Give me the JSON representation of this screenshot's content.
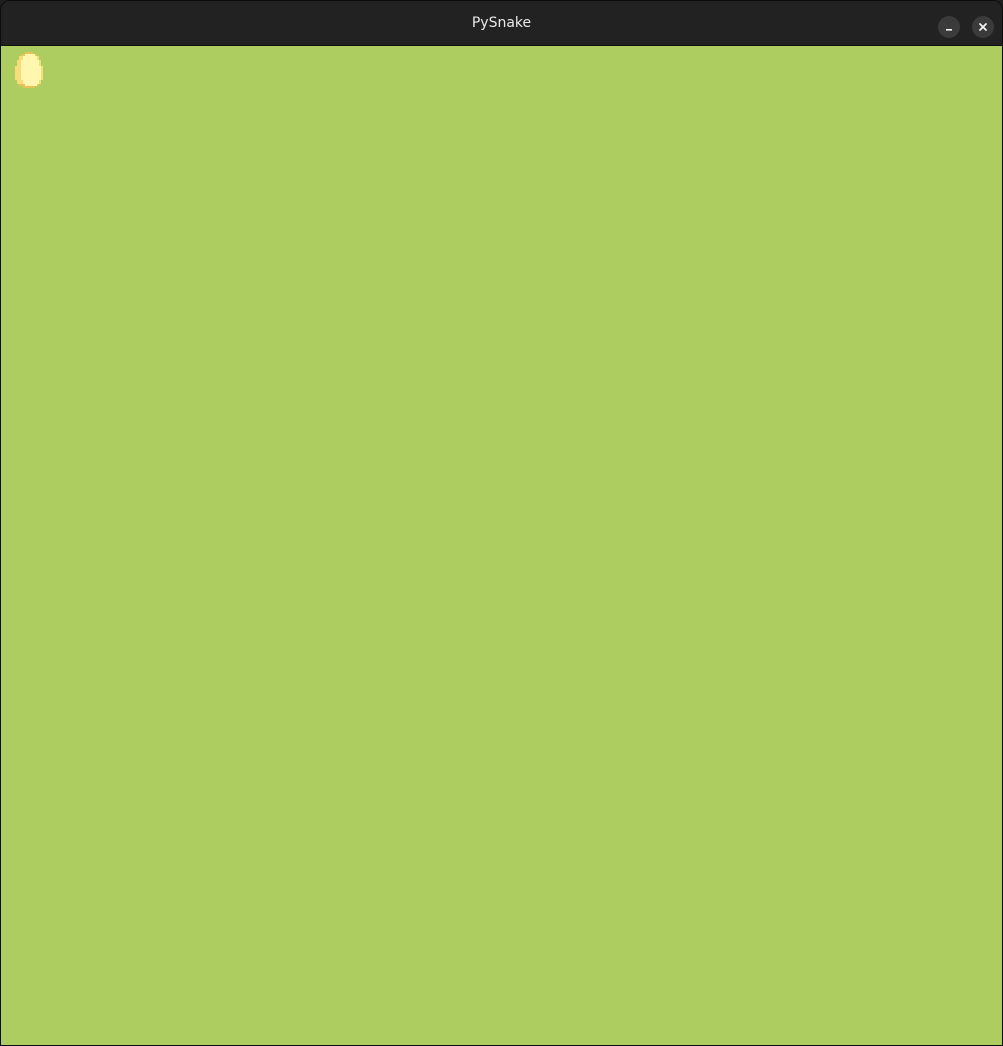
{
  "window": {
    "title": "PySnake",
    "controls": {
      "minimize_icon": "minimize-icon",
      "close_icon": "close-icon"
    }
  },
  "game": {
    "background_color": "#adcd61",
    "food": {
      "icon": "egg-icon",
      "colors": [
        "#fff6b0",
        "#f7dc7a",
        "#e9c25a"
      ]
    }
  }
}
